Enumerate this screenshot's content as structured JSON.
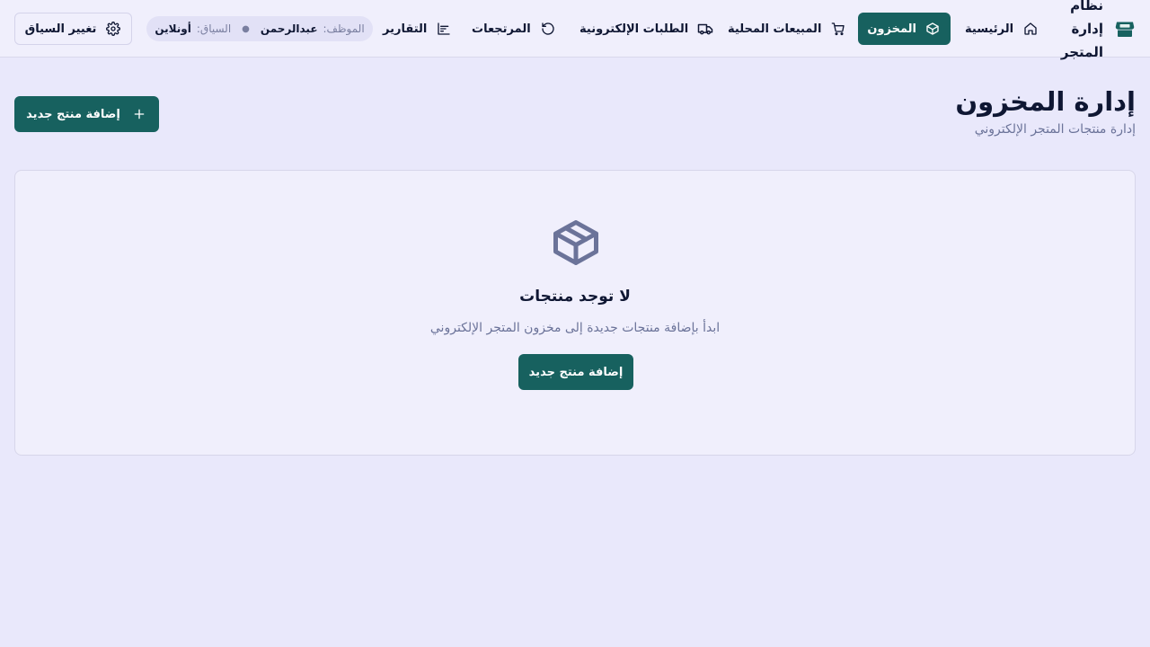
{
  "brand": {
    "title": "نظام إدارة المتجر",
    "icon": "store-icon"
  },
  "nav": {
    "items": [
      {
        "label": "الرئيسية",
        "icon": "home-icon",
        "active": false
      },
      {
        "label": "المخزون",
        "icon": "box-icon",
        "active": true
      },
      {
        "label": "المبيعات المحلية",
        "icon": "cart-icon",
        "active": false
      },
      {
        "label": "الطلبات الإلكترونية",
        "icon": "truck-icon",
        "active": false
      },
      {
        "label": "المرتجعات",
        "icon": "rotate-ccw-icon",
        "active": false
      },
      {
        "label": "التقارير",
        "icon": "chart-icon",
        "active": false
      }
    ]
  },
  "session": {
    "employee_label": "الموظف:",
    "employee_name": "عبدالرحمن",
    "context_label": "السياق:",
    "context_value": "أونلاين"
  },
  "actions": {
    "change_context": "تغيير السياق"
  },
  "page": {
    "title": "إدارة المخزون",
    "subtitle": "إدارة منتجات المتجر الإلكتروني",
    "add_button": "إضافة منتج جديد"
  },
  "empty_state": {
    "title": "لا توجد منتجات",
    "text": "ابدأ بإضافة منتجات جديدة إلى مخزون المتجر الإلكتروني",
    "button": "إضافة منتج جديد",
    "icon": "package-icon"
  },
  "colors": {
    "accent": "#17615f",
    "background": "#e9e8fb",
    "text": "#0f1733",
    "muted": "#6b7399"
  }
}
